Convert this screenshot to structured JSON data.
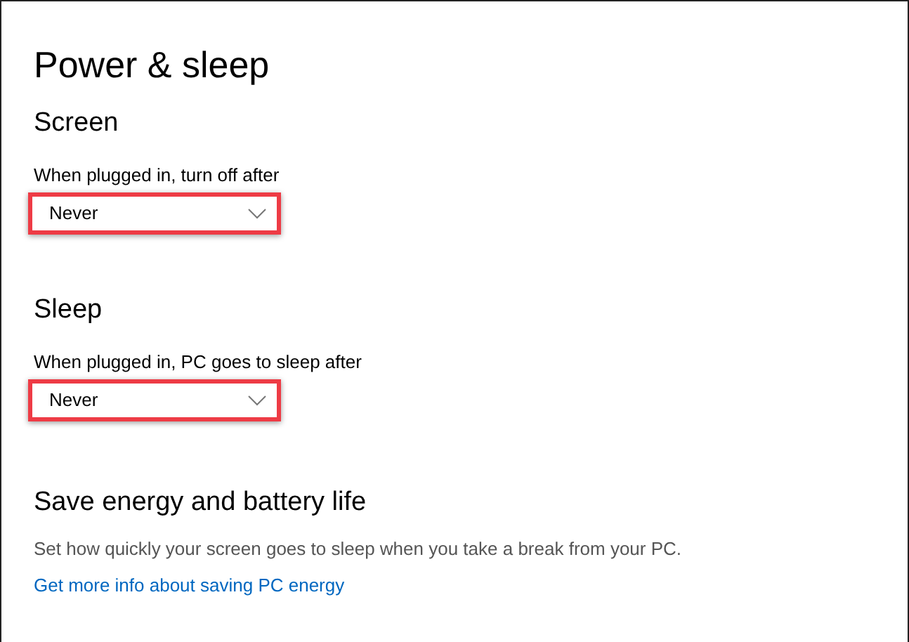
{
  "title": "Power & sleep",
  "sections": [
    {
      "heading": "Screen",
      "label": "When plugged in, turn off after",
      "dropdown": {
        "value": "Never",
        "highlighted": true
      }
    },
    {
      "heading": "Sleep",
      "label": "When plugged in, PC goes to sleep after",
      "dropdown": {
        "value": "Never",
        "highlighted": true
      }
    }
  ],
  "save_energy": {
    "heading": "Save energy and battery life",
    "description": "Set how quickly your screen goes to sleep when you take a break from your PC.",
    "link": "Get more info about saving PC energy"
  }
}
